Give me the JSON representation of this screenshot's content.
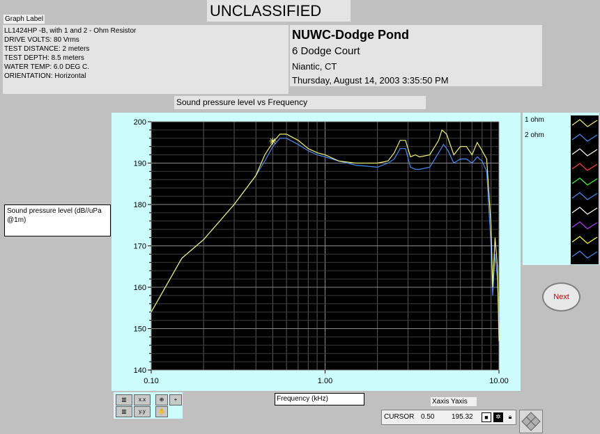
{
  "header": {
    "classification": "UNCLASSIFIED"
  },
  "graph_label": {
    "title": "Graph Label",
    "lines": [
      "LL1424HP -B,  with 1 and 2 -  Ohm Resistor",
      "DRIVE VOLTS: 80 Vrms",
      "TEST DISTANCE: 2 meters",
      "TEST DEPTH: 8.5 meters",
      "WATER TEMP: 6.0 DEG C.",
      "ORIENTATION: Horizontal"
    ]
  },
  "organization": {
    "name": "NUWC-Dodge Pond",
    "address": "6 Dodge Court",
    "city": "Niantic, CT",
    "datetime": "Thursday, August 14, 2003 3:35:50 PM"
  },
  "chart_data": {
    "type": "line",
    "title": "Sound pressure level vs Frequency",
    "xlabel": "Frequency (kHz)",
    "ylabel": "Sound pressure level (dB//uPa @1m)",
    "x_scale": "log",
    "xlim": [
      0.1,
      10.0
    ],
    "ylim": [
      140,
      200
    ],
    "x_ticks": [
      "0.10",
      "1.00",
      "10.00"
    ],
    "y_ticks": [
      "140",
      "150",
      "160",
      "170",
      "180",
      "190",
      "200"
    ],
    "grid": true,
    "legend_position": "right",
    "background": "#000000",
    "series": [
      {
        "name": "1 ohm",
        "color": "#f2f27a",
        "points": [
          [
            0.1,
            154
          ],
          [
            0.15,
            167
          ],
          [
            0.2,
            171.5
          ],
          [
            0.3,
            180
          ],
          [
            0.4,
            187
          ],
          [
            0.45,
            192
          ],
          [
            0.5,
            195
          ],
          [
            0.55,
            197
          ],
          [
            0.6,
            197
          ],
          [
            0.7,
            195.5
          ],
          [
            0.8,
            193.5
          ],
          [
            0.9,
            192.5
          ],
          [
            1.0,
            192
          ],
          [
            1.2,
            190.5
          ],
          [
            1.5,
            190
          ],
          [
            2.0,
            190
          ],
          [
            2.3,
            190.5
          ],
          [
            2.5,
            192.5
          ],
          [
            2.7,
            195.5
          ],
          [
            2.9,
            195.5
          ],
          [
            3.1,
            191.5
          ],
          [
            3.3,
            192
          ],
          [
            3.5,
            191.5
          ],
          [
            4.0,
            192
          ],
          [
            4.5,
            195.5
          ],
          [
            4.7,
            198
          ],
          [
            5.0,
            197
          ],
          [
            5.5,
            192
          ],
          [
            6.0,
            194
          ],
          [
            6.5,
            194
          ],
          [
            7.0,
            192
          ],
          [
            7.5,
            195
          ],
          [
            8.0,
            193
          ],
          [
            8.5,
            191
          ],
          [
            9.0,
            175
          ],
          [
            9.2,
            160
          ],
          [
            9.5,
            172
          ],
          [
            9.8,
            165
          ],
          [
            10.0,
            147
          ]
        ]
      },
      {
        "name": "2 ohm",
        "color": "#4a8cf0",
        "points": [
          [
            0.1,
            154
          ],
          [
            0.15,
            167
          ],
          [
            0.2,
            171.5
          ],
          [
            0.3,
            180
          ],
          [
            0.4,
            187
          ],
          [
            0.45,
            190.5
          ],
          [
            0.5,
            194
          ],
          [
            0.55,
            196
          ],
          [
            0.6,
            196
          ],
          [
            0.7,
            194.5
          ],
          [
            0.8,
            193
          ],
          [
            0.9,
            192
          ],
          [
            1.0,
            191.5
          ],
          [
            1.2,
            190.5
          ],
          [
            1.5,
            189.5
          ],
          [
            2.0,
            189
          ],
          [
            2.3,
            190
          ],
          [
            2.5,
            191
          ],
          [
            2.7,
            193.5
          ],
          [
            2.9,
            193.5
          ],
          [
            3.1,
            189
          ],
          [
            3.3,
            188.5
          ],
          [
            3.5,
            188.5
          ],
          [
            4.0,
            189
          ],
          [
            4.5,
            192.5
          ],
          [
            4.8,
            194.5
          ],
          [
            5.1,
            193
          ],
          [
            5.5,
            190
          ],
          [
            6.0,
            191
          ],
          [
            6.5,
            191
          ],
          [
            7.0,
            190
          ],
          [
            7.5,
            191.5
          ],
          [
            8.0,
            190.5
          ],
          [
            8.5,
            188
          ],
          [
            9.0,
            170
          ],
          [
            9.2,
            158
          ],
          [
            9.5,
            168
          ],
          [
            9.8,
            162
          ],
          [
            10.0,
            152
          ]
        ]
      }
    ],
    "cursor": {
      "x": 0.5,
      "y": 195.32
    }
  },
  "legend": {
    "entries": [
      "1 ohm",
      "2 ohm"
    ],
    "swatch_colors": [
      "#f2f27a",
      "#4a8cf0",
      "#ffffff",
      "#ff4040",
      "#40ff40",
      "#4a8cf0",
      "#ffffff",
      "#b040ff",
      "#ffff40",
      "#4a8cf0"
    ]
  },
  "controls": {
    "next_label": "Next",
    "palette_icons": [
      "x-scale-icon",
      "x-format-icon",
      "y-scale-icon",
      "y-format-icon",
      "zoom-icon",
      "crosshair-icon",
      "pan-hand-icon"
    ]
  },
  "cursor_display": {
    "header": "Xaxis   Yaxis",
    "label": "CURSOR",
    "x_value": "0.50",
    "y_value": "195.32"
  }
}
